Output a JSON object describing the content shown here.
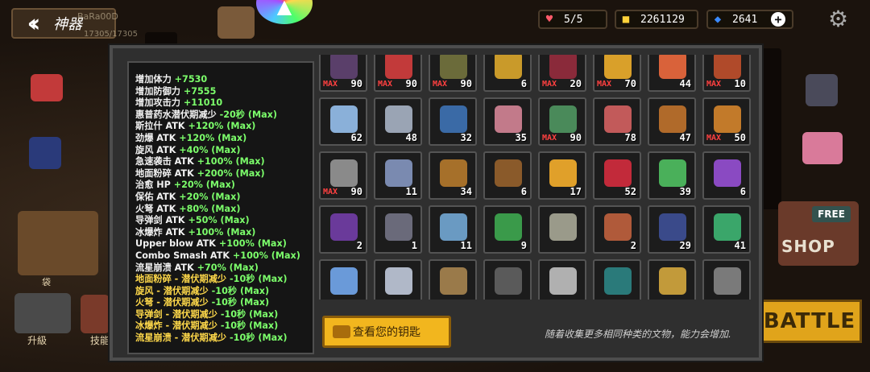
{
  "header": {
    "title": "神器",
    "player_name": "BaRa00D",
    "player_hp": "17305/17305",
    "hearts": "5/5",
    "gold": "2261129",
    "gems": "2641"
  },
  "side": {
    "bag_label": "袋",
    "upgrade_label": "升級",
    "skill_label": "技能",
    "free_label": "FREE",
    "shop_label": "SHOP",
    "battle_label": "BATTLE"
  },
  "stats": [
    {
      "name": "增加体力 ",
      "value": "+7530",
      "style": "w"
    },
    {
      "name": "增加防御力 ",
      "value": "+7555",
      "style": "w"
    },
    {
      "name": "增加攻击力 ",
      "value": "+11010",
      "style": "w"
    },
    {
      "name": "惠普药水潜伏期减少 ",
      "value": "-20秒 (Max)",
      "style": "w"
    },
    {
      "name": "斯拉什 ATK ",
      "value": "+120% (Max)",
      "style": "w"
    },
    {
      "name": "劲爆 ATK ",
      "value": "+120% (Max)",
      "style": "w"
    },
    {
      "name": "旋风 ATK ",
      "value": "+40% (Max)",
      "style": "w"
    },
    {
      "name": "急速袭击 ATK ",
      "value": "+100% (Max)",
      "style": "w"
    },
    {
      "name": "地面粉碎 ATK ",
      "value": "+200% (Max)",
      "style": "w"
    },
    {
      "name": "治愈 HP ",
      "value": "+20% (Max)",
      "style": "w"
    },
    {
      "name": "保佑 ATK ",
      "value": "+20% (Max)",
      "style": "w"
    },
    {
      "name": "火弩 ATK ",
      "value": "+80% (Max)",
      "style": "w"
    },
    {
      "name": "导弹剑 ATK ",
      "value": "+50% (Max)",
      "style": "w"
    },
    {
      "name": "冰爆炸 ATK ",
      "value": "+100% (Max)",
      "style": "w"
    },
    {
      "name": "Upper blow ATK ",
      "value": "+100% (Max)",
      "style": "w"
    },
    {
      "name": "Combo Smash ATK ",
      "value": "+100% (Max)",
      "style": "w"
    },
    {
      "name": "流星崩溃 ATK ",
      "value": "+70% (Max)",
      "style": "w"
    },
    {
      "name": "地面粉碎 - 潜伏期减少 ",
      "value": "-10秒 (Max)",
      "style": "y"
    },
    {
      "name": "旋风 - 潜伏期减少 ",
      "value": "-10秒 (Max)",
      "style": "y"
    },
    {
      "name": "火弩 - 潜伏期减少 ",
      "value": "-10秒 (Max)",
      "style": "y"
    },
    {
      "name": "导弹剑 - 潜伏期减少 ",
      "value": "-10秒 (Max)",
      "style": "y"
    },
    {
      "name": "冰爆炸 - 潜伏期减少 ",
      "value": "-10秒 (Max)",
      "style": "y"
    },
    {
      "name": "流星崩溃 - 潜伏期减少 ",
      "value": "-10秒 (Max)",
      "style": "y"
    }
  ],
  "artifacts": [
    {
      "name": "horn",
      "max": "MAX",
      "count": "90",
      "color": "#5a3f6a"
    },
    {
      "name": "red-berries",
      "max": "MAX",
      "count": "90",
      "color": "#c23a3a"
    },
    {
      "name": "beast-helm",
      "max": "MAX",
      "count": "90",
      "color": "#6b6b3a"
    },
    {
      "name": "golden-hammer",
      "max": "",
      "count": "6",
      "color": "#c99a2a"
    },
    {
      "name": "red-robe",
      "max": "MAX",
      "count": "20",
      "color": "#8a2a3a"
    },
    {
      "name": "gold-ring",
      "max": "MAX",
      "count": "70",
      "color": "#d9a02a"
    },
    {
      "name": "meat",
      "max": "",
      "count": "44",
      "color": "#d9623a"
    },
    {
      "name": "lantern",
      "max": "MAX",
      "count": "10",
      "color": "#b04a2a"
    },
    {
      "name": "pearl-shell",
      "max": "",
      "count": "62",
      "color": "#8ab0d9"
    },
    {
      "name": "sword",
      "max": "",
      "count": "48",
      "color": "#9aa4b4"
    },
    {
      "name": "shield-emblem",
      "max": "",
      "count": "32",
      "color": "#3a6aa6"
    },
    {
      "name": "crystal-shards",
      "max": "",
      "count": "35",
      "color": "#c27a8a"
    },
    {
      "name": "green-claw",
      "max": "MAX",
      "count": "90",
      "color": "#4a8a5a"
    },
    {
      "name": "potion",
      "max": "",
      "count": "78",
      "color": "#c25a5a"
    },
    {
      "name": "rune-tablet",
      "max": "",
      "count": "47",
      "color": "#b06a2a"
    },
    {
      "name": "skull-pot",
      "max": "MAX",
      "count": "50",
      "color": "#c27a2a"
    },
    {
      "name": "stone-block",
      "max": "MAX",
      "count": "90",
      "color": "#8a8a8a"
    },
    {
      "name": "rope",
      "max": "",
      "count": "11",
      "color": "#7a8ab0"
    },
    {
      "name": "amulet",
      "max": "",
      "count": "34",
      "color": "#a6702a"
    },
    {
      "name": "staff",
      "max": "",
      "count": "6",
      "color": "#8a5a2a"
    },
    {
      "name": "orange",
      "max": "",
      "count": "17",
      "color": "#e0a02a"
    },
    {
      "name": "berries",
      "max": "",
      "count": "52",
      "color": "#c22a3a"
    },
    {
      "name": "green-fruit",
      "max": "",
      "count": "39",
      "color": "#4ab05a"
    },
    {
      "name": "purple-vial",
      "max": "",
      "count": "6",
      "color": "#8a4ac2"
    },
    {
      "name": "purple-shield",
      "max": "",
      "count": "2",
      "color": "#6a3a9a"
    },
    {
      "name": "gauntlet",
      "max": "",
      "count": "1",
      "color": "#6a6a7a"
    },
    {
      "name": "ice-shards",
      "max": "",
      "count": "11",
      "color": "#6a9ac2"
    },
    {
      "name": "green-sack",
      "max": "",
      "count": "9",
      "color": "#3a9a4a"
    },
    {
      "name": "scroll",
      "max": "",
      "count": "",
      "color": "#9a9a8a"
    },
    {
      "name": "hat",
      "max": "",
      "count": "2",
      "color": "#b05a3a"
    },
    {
      "name": "boot",
      "max": "",
      "count": "29",
      "color": "#3a4a8a"
    },
    {
      "name": "emerald-pendant",
      "max": "",
      "count": "41",
      "color": "#3aa66a"
    },
    {
      "name": "arrow",
      "max": "",
      "count": "",
      "color": "#6a9ad9"
    },
    {
      "name": "diamond",
      "max": "",
      "count": "",
      "color": "#b0b8c8"
    },
    {
      "name": "compass",
      "max": "",
      "count": "",
      "color": "#9a7a4a"
    },
    {
      "name": "dark-frame",
      "max": "",
      "count": "",
      "color": "#5a5a5a"
    },
    {
      "name": "fang",
      "max": "",
      "count": "",
      "color": "#b0b0b0"
    },
    {
      "name": "teal-orb",
      "max": "",
      "count": "",
      "color": "#2a7a7a"
    },
    {
      "name": "candelabra",
      "max": "",
      "count": "",
      "color": "#c29a3a"
    },
    {
      "name": "iron-boots",
      "max": "",
      "count": "",
      "color": "#7a7a7a"
    }
  ],
  "key_button": "查看您的钥匙",
  "hint": "随着收集更多相同种类的文物，能力会增加."
}
